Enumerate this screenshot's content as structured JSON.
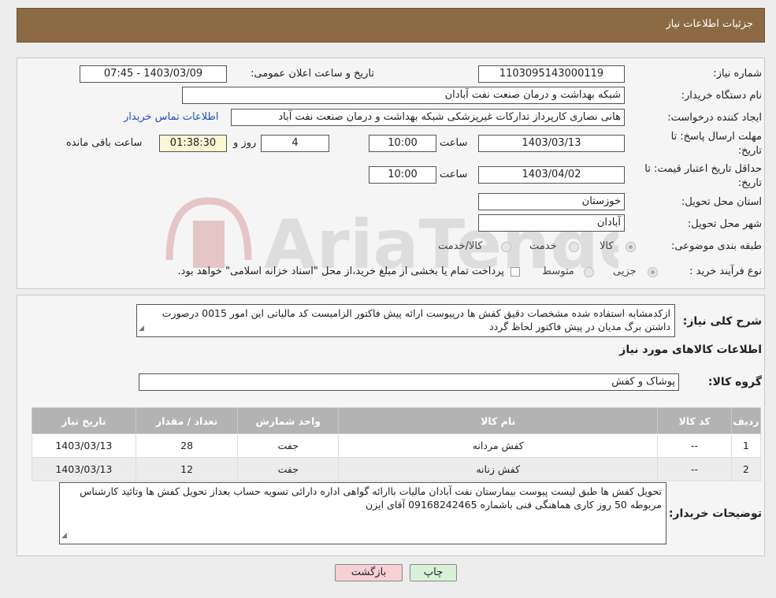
{
  "header": {
    "title": "جزئیات اطلاعات نیاز"
  },
  "form": {
    "need_number_label": "شماره نیاز:",
    "need_number": "1103095143000119",
    "announce_label": "تاریخ و ساعت اعلان عمومی:",
    "announce_value": "1403/03/09 - 07:45",
    "buyer_org_label": "نام دستگاه خریدار:",
    "buyer_org": "شبکه بهداشت و درمان صنعت نفت آبادان",
    "requester_label": "ایجاد کننده درخواست:",
    "requester": "هانی نصاری کارپرداز تدارکات غیرپزشکی شبکه بهداشت و درمان صنعت نفت آباد",
    "contact_link": "اطلاعات تماس خریدار",
    "deadline_label_1": "مهلت ارسال پاسخ: تا",
    "deadline_label_2": "تاریخ:",
    "deadline_date": "1403/03/13",
    "time_label": "ساعت",
    "deadline_time": "10:00",
    "days_value": "4",
    "days_label": "روز و",
    "remaining_time": "01:38:30",
    "remaining_label": "ساعت باقی مانده",
    "validity_label_1": "حداقل تاریخ اعتبار قیمت: تا",
    "validity_label_2": "تاریخ:",
    "validity_date": "1403/04/02",
    "validity_time": "10:00",
    "province_label": "استان محل تحویل:",
    "province": "خوزستان",
    "city_label": "شهر محل تحویل:",
    "city": "آبادان",
    "category_label": "طبقه بندی موضوعی:",
    "category_options": [
      "کالا",
      "خدمت",
      "کالا/خدمت"
    ],
    "process_label": "نوع فرآیند خرید :",
    "process_options": [
      "جزیی",
      "متوسط"
    ],
    "process_note": "پرداخت تمام یا بخشی از مبلغ خرید،از محل \"اسناد خزانه اسلامی\" خواهد بود."
  },
  "details": {
    "description_label": "شرح کلی نیاز:",
    "description": "ازکدمشابه استفاده شده مشخصات دقیق کفش ها درپیوست ارائه پیش فاکتور الزامیست کد مالیاتی این امور 0015 درصورت داشتن برگ مدیان در پیش فاکتور لحاظ گردد",
    "items_heading": "اطلاعات کالاهای مورد نیاز",
    "group_label": "گروه کالا:",
    "group_value": "پوشاک و کفش",
    "columns": [
      "ردیف",
      "کد کالا",
      "نام کالا",
      "واحد شمارش",
      "تعداد / مقدار",
      "تاریخ نیاز"
    ],
    "rows": [
      [
        "1",
        "--",
        "کفش مردانه",
        "جفت",
        "28",
        "1403/03/13"
      ],
      [
        "2",
        "--",
        "کفش زنانه",
        "جفت",
        "12",
        "1403/03/13"
      ]
    ],
    "buyer_notes_label": "توضیحات خریدار:",
    "buyer_notes": "تحویل کفش ها طبق لیست پیوست بیمارستان نفت آبادان مالیات باارائه گواهی اداره دارائی تسویه حساب بعداز تحویل کفش ها وتائید کارشناس مربوطه 50 روز کاری هماهنگی فنی باشماره 09168242465 آقای ایزن"
  },
  "buttons": {
    "print": "چاپ",
    "back": "بازگشت"
  },
  "watermark": {
    "text": "AriaTender.neT"
  },
  "colors": {
    "header": "#8b6a44",
    "link": "#1a4fc7",
    "table_header": "#b3b3b3",
    "back_button": "#f6d0d4",
    "print_button": "#d9f1d9"
  }
}
